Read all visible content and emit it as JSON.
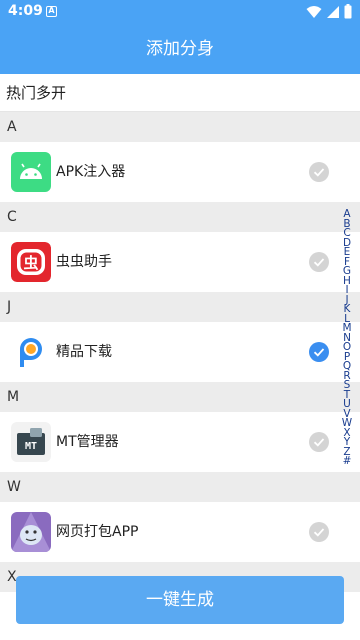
{
  "status_bar": {
    "time": "4:09",
    "badge": "A"
  },
  "app_bar": {
    "title": "添加分身"
  },
  "hot_label": "热门多开",
  "sections": [
    {
      "letter": "A",
      "app": {
        "name": "APK注入器",
        "icon": "android-icon",
        "checked": false
      }
    },
    {
      "letter": "C",
      "app": {
        "name": "虫虫助手",
        "icon": "chongchong-icon",
        "checked": false
      }
    },
    {
      "letter": "J",
      "app": {
        "name": "精品下载",
        "icon": "pp-download-icon",
        "checked": true
      }
    },
    {
      "letter": "M",
      "app": {
        "name": "MT管理器",
        "icon": "mt-manager-icon",
        "checked": false
      }
    },
    {
      "letter": "W",
      "app": {
        "name": "网页打包APP",
        "icon": "web-pack-icon",
        "checked": false
      }
    },
    {
      "letter": "X"
    }
  ],
  "alpha_index": [
    "A",
    "B",
    "C",
    "D",
    "E",
    "F",
    "G",
    "H",
    "I",
    "J",
    "K",
    "L",
    "M",
    "N",
    "O",
    "P",
    "Q",
    "R",
    "S",
    "T",
    "U",
    "V",
    "W",
    "X",
    "Y",
    "Z",
    "#"
  ],
  "bottom_button": {
    "label": "一键生成"
  },
  "colors": {
    "primary": "#4aa3f5",
    "check_on": "#3a8ef0",
    "check_off": "#d4d4d4",
    "section_bg": "#ececec"
  }
}
